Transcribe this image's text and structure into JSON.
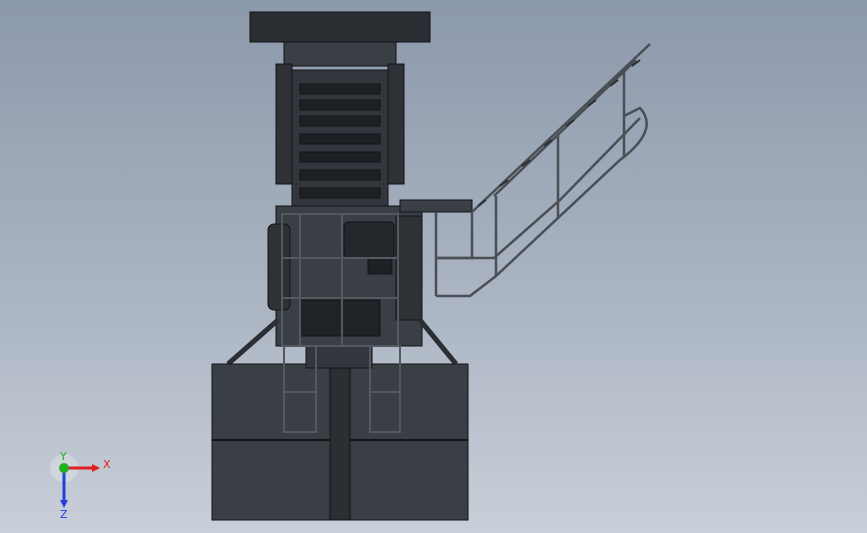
{
  "view": {
    "background_top": "#8c99ab",
    "background_bottom": "#c9cfd8",
    "model_color": "#3a3f46",
    "model_edge_color": "#111316",
    "rail_color": "#4a4f55"
  },
  "triad": {
    "x_label": "X",
    "y_label": "Y",
    "z_label": "Z",
    "x_color": "#e02020",
    "y_color": "#20b020",
    "z_color": "#2040e0"
  }
}
